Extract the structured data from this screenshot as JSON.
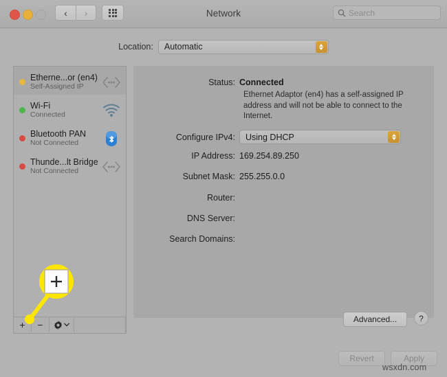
{
  "window": {
    "title": "Network",
    "traffic_lights": [
      "close",
      "minimize",
      "zoom"
    ],
    "nav_back_icon": "chevron-left-icon",
    "nav_forward_icon": "chevron-right-icon",
    "grid_icon": "grid-all-preferences-icon"
  },
  "search": {
    "placeholder": "Search",
    "value": "",
    "icon": "search-icon"
  },
  "location": {
    "label": "Location:",
    "value": "Automatic",
    "options": [
      "Automatic"
    ]
  },
  "sidebar": {
    "services": [
      {
        "name": "Etherne...or (en4)",
        "status": "Self-Assigned IP",
        "dot_color": "#e8b83c",
        "icon": "ethernet-icon",
        "selected": true
      },
      {
        "name": "Wi-Fi",
        "status": "Connected",
        "dot_color": "#4cb84c",
        "icon": "wifi-icon",
        "selected": false
      },
      {
        "name": "Bluetooth PAN",
        "status": "Not Connected",
        "dot_color": "#d94a42",
        "icon": "bluetooth-icon",
        "selected": false
      },
      {
        "name": "Thunde...lt Bridge",
        "status": "Not Connected",
        "dot_color": "#d94a42",
        "icon": "ethernet-icon",
        "selected": false
      }
    ],
    "toolbar": {
      "add_label": "+",
      "remove_label": "−",
      "gear_icon": "gear-icon",
      "gear_chevron_icon": "chevron-down-icon"
    }
  },
  "details": {
    "status_label": "Status:",
    "status_value": "Connected",
    "status_description": "Ethernet Adaptor (en4) has a self-assigned IP address and will not be able to connect to the Internet.",
    "configure_ipv4_label": "Configure IPv4:",
    "configure_ipv4_value": "Using DHCP",
    "configure_ipv4_options": [
      "Using DHCP"
    ],
    "ip_address_label": "IP Address:",
    "ip_address_value": "169.254.89.250",
    "subnet_mask_label": "Subnet Mask:",
    "subnet_mask_value": "255.255.0.0",
    "router_label": "Router:",
    "router_value": "",
    "dns_server_label": "DNS Server:",
    "dns_server_value": "",
    "search_domains_label": "Search Domains:",
    "search_domains_value": "",
    "advanced_label": "Advanced...",
    "help_label": "?"
  },
  "footer": {
    "revert_label": "Revert",
    "apply_label": "Apply"
  },
  "callout": {
    "magnified_glyph": "+",
    "highlight_color": "#ffe600",
    "target": "add-service-button"
  },
  "watermark": "wsxdn.com"
}
